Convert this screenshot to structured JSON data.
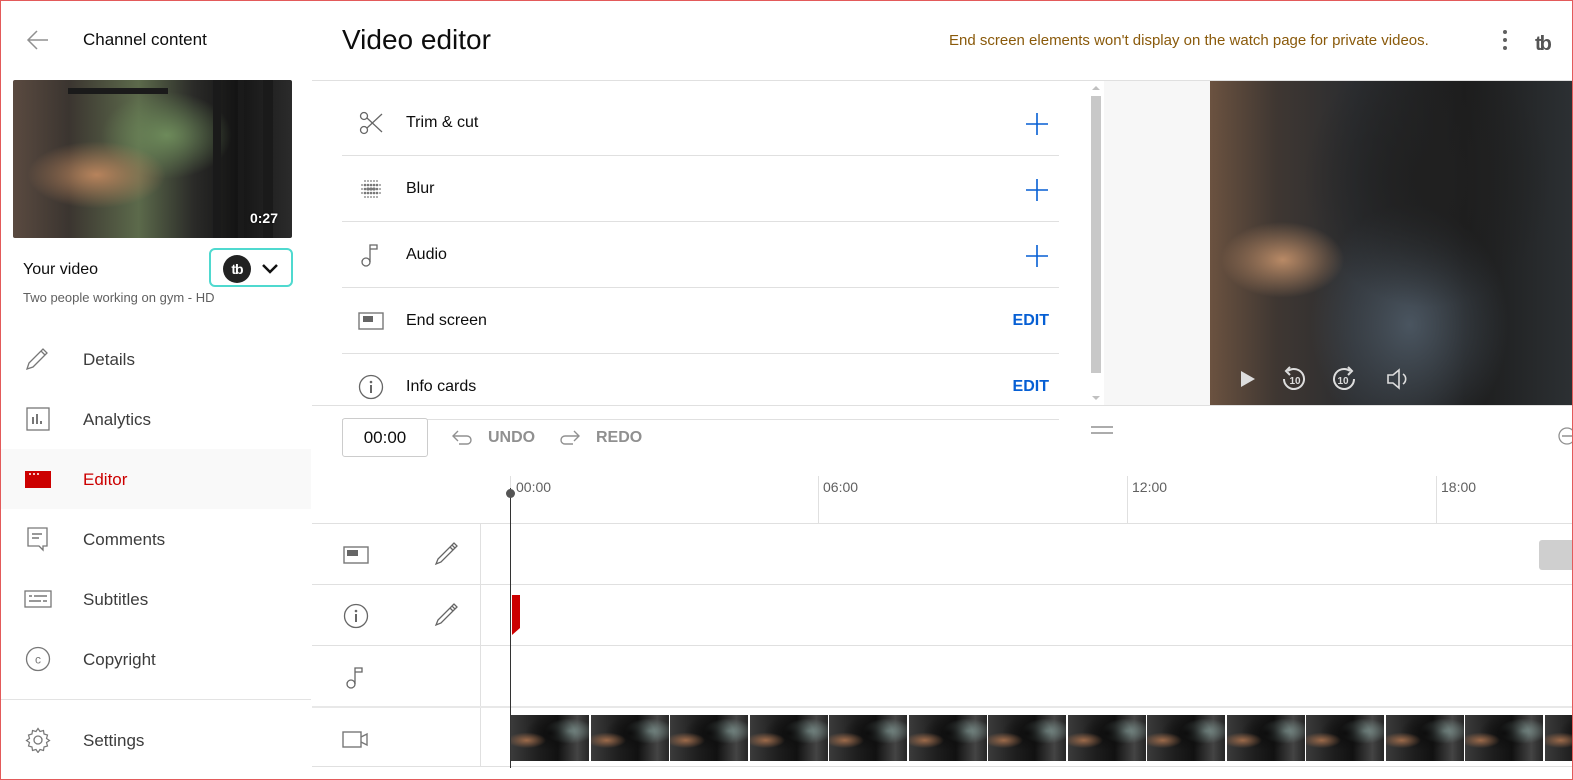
{
  "sidebar": {
    "back_label": "Channel content",
    "thumbnail": {
      "duration": "0:27"
    },
    "your_video_label": "Your video",
    "video_title": "Two people working on gym - HD",
    "extension_logo": "tb",
    "nav": [
      {
        "label": "Details",
        "icon": "pencil-icon",
        "active": false
      },
      {
        "label": "Analytics",
        "icon": "analytics-icon",
        "active": false
      },
      {
        "label": "Editor",
        "icon": "clapperboard-icon",
        "active": true
      },
      {
        "label": "Comments",
        "icon": "comment-icon",
        "active": false
      },
      {
        "label": "Subtitles",
        "icon": "subtitles-icon",
        "active": false
      },
      {
        "label": "Copyright",
        "icon": "copyright-icon",
        "active": false
      }
    ],
    "settings_label": "Settings"
  },
  "header": {
    "title": "Video editor",
    "warning": "End screen elements won't display on the watch page for private videos.",
    "corner_logo": "tb"
  },
  "tools": [
    {
      "label": "Trim & cut",
      "icon": "scissors-icon",
      "action": "plus"
    },
    {
      "label": "Blur",
      "icon": "blur-icon",
      "action": "plus"
    },
    {
      "label": "Audio",
      "icon": "music-note-icon",
      "action": "plus"
    },
    {
      "label": "End screen",
      "icon": "end-screen-icon",
      "action": "edit",
      "action_label": "EDIT"
    },
    {
      "label": "Info cards",
      "icon": "info-icon",
      "action": "edit",
      "action_label": "EDIT"
    }
  ],
  "timeline": {
    "current_time": "00:00",
    "undo_label": "UNDO",
    "redo_label": "REDO",
    "ticks": [
      "00:00",
      "06:00",
      "12:00",
      "18:00"
    ],
    "tracks": [
      "end-screen",
      "info-cards",
      "audio",
      "video"
    ]
  },
  "colors": {
    "accent_red": "#cc0000",
    "link_blue": "#065fd4",
    "warning_text": "#8a5a0b",
    "extension_border": "#4fd9cf"
  }
}
